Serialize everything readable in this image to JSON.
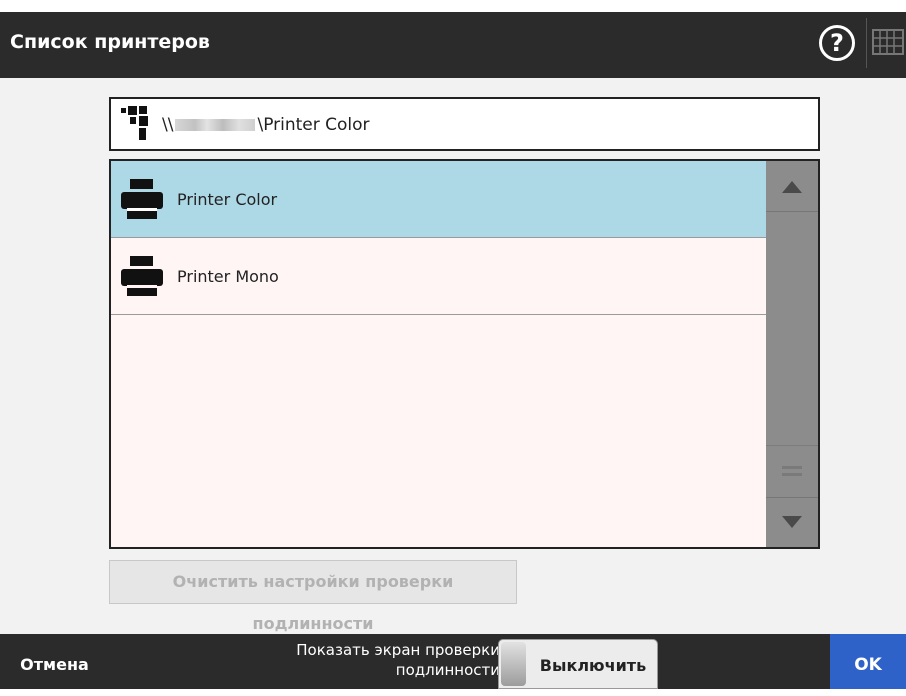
{
  "header": {
    "title": "Список принтеров",
    "help_symbol": "?",
    "help_icon": "help-icon",
    "keyboard_icon": "keyboard-icon"
  },
  "path_field": {
    "icon": "network-icon",
    "prefix": "\\\\",
    "suffix": "\\Printer Color"
  },
  "printer_list": {
    "items": [
      {
        "label": "Printer Color",
        "icon": "printer-icon",
        "selected": true
      },
      {
        "label": "Printer Mono",
        "icon": "printer-icon",
        "selected": false
      }
    ]
  },
  "clear_button": {
    "label": "Очистить настройки проверки подлинности",
    "enabled": false
  },
  "footer": {
    "cancel_label": "Отмена",
    "auth_label_line1": "Показать экран проверки",
    "auth_label_line2": "подлинности",
    "toggle_label": "Выключить",
    "ok_label": "OK"
  },
  "colors": {
    "header_bg": "#2b2b2b",
    "selected_row": "#add8e5",
    "list_bg": "#fff5f5",
    "ok_button": "#2e62c8"
  }
}
